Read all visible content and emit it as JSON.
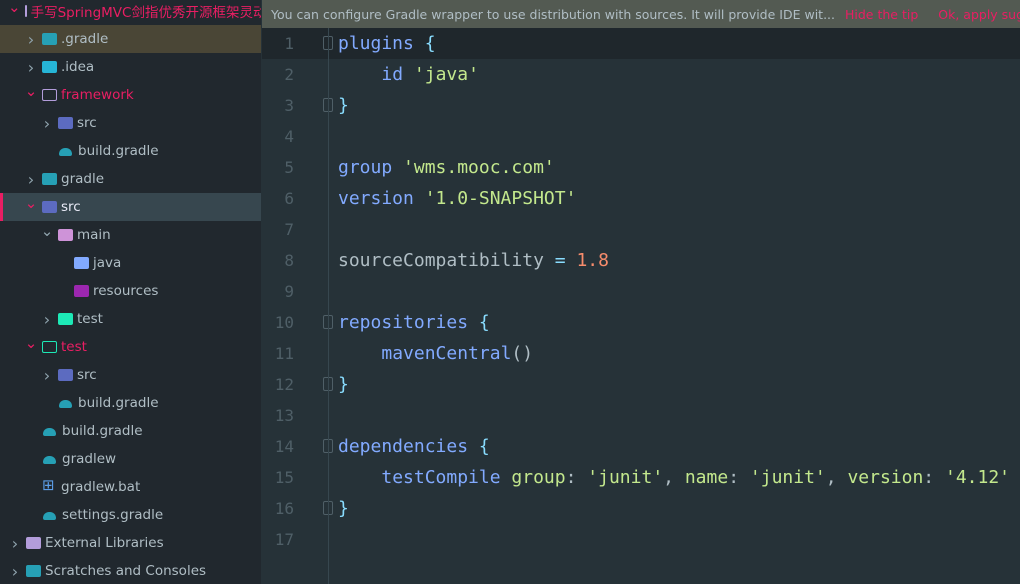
{
  "tree": [
    {
      "label": "手写SpringMVC剑指优秀开源框架灵动",
      "level": 0,
      "arrow": "down",
      "icon": "folder-outline",
      "color": "#e91e63",
      "folder": "#b39ddb"
    },
    {
      "label": ".gradle",
      "level": 1,
      "arrow": "right",
      "icon": "folder",
      "color": "#b0bec5",
      "folder": "#26a0b5",
      "hl": true
    },
    {
      "label": ".idea",
      "level": 1,
      "arrow": "right",
      "icon": "folder",
      "color": "#b0bec5",
      "folder": "#26b5d6"
    },
    {
      "label": "framework",
      "level": 1,
      "arrow": "down",
      "icon": "folder-outline",
      "color": "#e91e63",
      "folder": "#b39ddb"
    },
    {
      "label": "src",
      "level": 2,
      "arrow": "right",
      "icon": "folder",
      "color": "#b0bec5",
      "folder": "#5c6bc0"
    },
    {
      "label": "build.gradle",
      "level": 2,
      "arrow": "",
      "icon": "gradle",
      "color": "#b0bec5"
    },
    {
      "label": "gradle",
      "level": 1,
      "arrow": "right",
      "icon": "folder",
      "color": "#b0bec5",
      "folder": "#26a0b5"
    },
    {
      "label": "src",
      "level": 1,
      "arrow": "down",
      "icon": "folder",
      "color": "#e8eaf6",
      "folder": "#5c6bc0",
      "sel": true
    },
    {
      "label": "main",
      "level": 2,
      "arrow": "down",
      "icon": "folder",
      "color": "#b0bec5",
      "folder": "#ce93d8"
    },
    {
      "label": "java",
      "level": 3,
      "arrow": "",
      "icon": "folder",
      "color": "#b0bec5",
      "folder": "#82aaff"
    },
    {
      "label": "resources",
      "level": 3,
      "arrow": "",
      "icon": "folder",
      "color": "#b0bec5",
      "folder": "#9c27b0"
    },
    {
      "label": "test",
      "level": 2,
      "arrow": "right",
      "icon": "folder",
      "color": "#b0bec5",
      "folder": "#1de9b6"
    },
    {
      "label": "test",
      "level": 1,
      "arrow": "down",
      "icon": "folder-outline",
      "color": "#e91e63",
      "folder": "#1de9b6"
    },
    {
      "label": "src",
      "level": 2,
      "arrow": "right",
      "icon": "folder",
      "color": "#b0bec5",
      "folder": "#5c6bc0"
    },
    {
      "label": "build.gradle",
      "level": 2,
      "arrow": "",
      "icon": "gradle",
      "color": "#b0bec5"
    },
    {
      "label": "build.gradle",
      "level": 1,
      "arrow": "",
      "icon": "gradle",
      "color": "#b0bec5"
    },
    {
      "label": "gradlew",
      "level": 1,
      "arrow": "",
      "icon": "gradle",
      "color": "#b0bec5"
    },
    {
      "label": "gradlew.bat",
      "level": 1,
      "arrow": "",
      "icon": "win",
      "color": "#b0bec5"
    },
    {
      "label": "settings.gradle",
      "level": 1,
      "arrow": "",
      "icon": "gradle",
      "color": "#b0bec5"
    },
    {
      "label": "External Libraries",
      "level": 0,
      "arrow": "right",
      "icon": "folder",
      "color": "#b0bec5",
      "folder": "#b39ddb"
    },
    {
      "label": "Scratches and Consoles",
      "level": 0,
      "arrow": "right",
      "icon": "folder",
      "color": "#b0bec5",
      "folder": "#26a0b5"
    }
  ],
  "tip": {
    "text": "You can configure Gradle wrapper to use distribution with sources. It will provide IDE wit...",
    "hide": "Hide the tip",
    "apply": "Ok, apply suggestion!"
  },
  "editor": {
    "current_line": 1,
    "lines": [
      {
        "n": "1",
        "fold": true,
        "tokens": [
          [
            "kw",
            "plugins"
          ],
          [
            "pl",
            " "
          ],
          [
            "br",
            "{"
          ]
        ]
      },
      {
        "n": "2",
        "tokens": [
          [
            "pl",
            "    "
          ],
          [
            "kw",
            "id"
          ],
          [
            "pl",
            " "
          ],
          [
            "str",
            "'java'"
          ]
        ]
      },
      {
        "n": "3",
        "fold": true,
        "tokens": [
          [
            "br",
            "}"
          ]
        ]
      },
      {
        "n": "4",
        "tokens": []
      },
      {
        "n": "5",
        "tokens": [
          [
            "kw",
            "group"
          ],
          [
            "pl",
            " "
          ],
          [
            "str",
            "'wms.mooc.com'"
          ]
        ]
      },
      {
        "n": "6",
        "tokens": [
          [
            "kw",
            "version"
          ],
          [
            "pl",
            " "
          ],
          [
            "str",
            "'1.0-SNAPSHOT'"
          ]
        ]
      },
      {
        "n": "7",
        "tokens": []
      },
      {
        "n": "8",
        "tokens": [
          [
            "pl",
            "sourceCompatibility "
          ],
          [
            "br",
            "="
          ],
          [
            "pl",
            " "
          ],
          [
            "num",
            "1.8"
          ]
        ]
      },
      {
        "n": "9",
        "tokens": []
      },
      {
        "n": "10",
        "fold": true,
        "tokens": [
          [
            "kw",
            "repositories"
          ],
          [
            "pl",
            " "
          ],
          [
            "br",
            "{"
          ]
        ]
      },
      {
        "n": "11",
        "tokens": [
          [
            "pl",
            "    "
          ],
          [
            "kw",
            "mavenCentral"
          ],
          [
            "pl",
            "()"
          ]
        ]
      },
      {
        "n": "12",
        "fold": true,
        "tokens": [
          [
            "br",
            "}"
          ]
        ]
      },
      {
        "n": "13",
        "tokens": []
      },
      {
        "n": "14",
        "fold": true,
        "tokens": [
          [
            "kw",
            "dependencies"
          ],
          [
            "pl",
            " "
          ],
          [
            "br",
            "{"
          ]
        ]
      },
      {
        "n": "15",
        "tokens": [
          [
            "pl",
            "    "
          ],
          [
            "kw",
            "testCompile"
          ],
          [
            "pl",
            " "
          ],
          [
            "arg",
            "group"
          ],
          [
            "pl",
            ": "
          ],
          [
            "str",
            "'junit'"
          ],
          [
            "pl",
            ", "
          ],
          [
            "arg",
            "name"
          ],
          [
            "pl",
            ": "
          ],
          [
            "str",
            "'junit'"
          ],
          [
            "pl",
            ", "
          ],
          [
            "arg",
            "version"
          ],
          [
            "pl",
            ": "
          ],
          [
            "str",
            "'4.12'"
          ]
        ]
      },
      {
        "n": "16",
        "fold": true,
        "tokens": [
          [
            "br",
            "}"
          ]
        ]
      },
      {
        "n": "17",
        "tokens": []
      }
    ]
  }
}
